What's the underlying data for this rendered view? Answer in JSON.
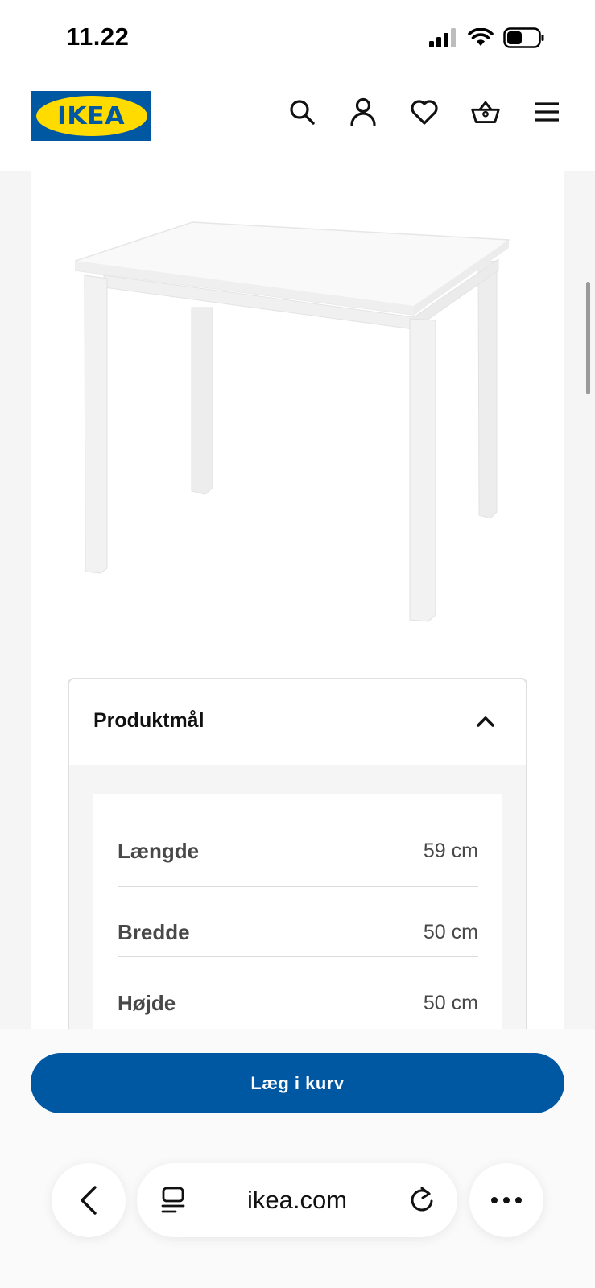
{
  "status_bar": {
    "time": "11.22"
  },
  "header": {
    "logo_text": "IKEA",
    "icons": [
      "search-icon",
      "account-icon",
      "heart-icon",
      "basket-icon",
      "menu-icon"
    ]
  },
  "colors": {
    "brand_blue": "#0058a3",
    "brand_yellow": "#ffdb00",
    "panel_bg": "#f5f5f5"
  },
  "product": {
    "image": "white-kids-table"
  },
  "accordion": {
    "title": "Produktmål",
    "expanded": true,
    "rows": [
      {
        "label": "Længde",
        "value": "59 cm"
      },
      {
        "label": "Bredde",
        "value": "50 cm"
      },
      {
        "label": "Højde",
        "value": "50 cm"
      }
    ]
  },
  "cart": {
    "button_label": "Læg i kurv"
  },
  "browser": {
    "url": "ikea.com"
  }
}
